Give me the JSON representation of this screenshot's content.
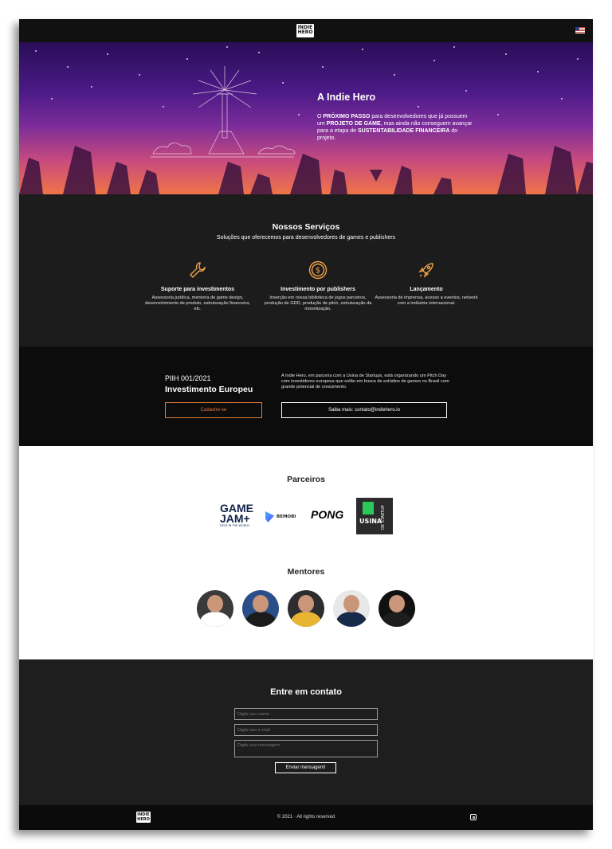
{
  "nav": {
    "logo_line1": "INDIE",
    "logo_line2": "HERO",
    "flag_icon": "us-flag-icon"
  },
  "hero": {
    "title": "A Indie Hero",
    "desc": [
      {
        "t": "O ",
        "b": false
      },
      {
        "t": "PRÓXIMO PASSO",
        "b": true
      },
      {
        "t": " para desenvolvedores que já possuem um ",
        "b": false
      },
      {
        "t": "PROJETO DE GAME",
        "b": true
      },
      {
        "t": ", mas ainda não conseguem avançar para a etapa de ",
        "b": false
      },
      {
        "t": "SUSTENTABILIDADE FINANCEIRA",
        "b": true
      },
      {
        "t": " do projeto.",
        "b": false
      }
    ]
  },
  "services": {
    "title": "Nossos Serviços",
    "subtitle": "Soluções que oferecemos para desenvolvedores de games e publishers",
    "items": [
      {
        "title": "Suporte para investimentos",
        "desc": "Assessoria jurídica, mentoria de game design, desenvolvimento de produto, estruturação financeira, etc.",
        "icon": "wrench-icon"
      },
      {
        "title": "Investimento por publishers",
        "desc": "Inserção em nossa biblioteca de jogos parceiros, produção de GDD, produção de pitch, estruturação da monetização.",
        "icon": "dollar-coin-icon"
      },
      {
        "title": "Lançamento",
        "desc": "Assessoria de imprensa, acesso a eventos, network com a indústria internacional.",
        "icon": "rocket-icon"
      }
    ],
    "accent": "#f0a24a"
  },
  "pitch": {
    "code": "PIIH 001/2021",
    "title": "Investimento Europeu",
    "text": "A Indie Hero, em parceria com a Usina de Startups, está organizando um Pitch Day com investidores europeus que estão em busca de estúdios de games no Brasil com grande potencial de crescimento.",
    "register_button": "Cadastre-se",
    "more_button": "Saiba mais: contato@indiehero.io"
  },
  "partners": {
    "title": "Parceiros",
    "gamejam_line1": "GAME",
    "gamejam_line2": "JAM+",
    "gamejam_tag": "DEVS IN THE WORLD",
    "bemobi": "BEMOBI",
    "pong": "PONG",
    "usina": "USINA",
    "usina_vertical": "DE STARTUP"
  },
  "mentors": {
    "title": "Mentores",
    "people": [
      {
        "bg": "#3a3a3a",
        "suit": "#ffffff"
      },
      {
        "bg": "#2a4f88",
        "suit": "#1b1b1b"
      },
      {
        "bg": "#2d2d30",
        "suit": "#e7b531"
      },
      {
        "bg": "#e8e8e8",
        "suit": "#182a4a"
      },
      {
        "bg": "#111111",
        "suit": "#1d1d1d"
      }
    ]
  },
  "contact": {
    "title": "Entre em contato",
    "name_placeholder": "Digite seu nome",
    "email_placeholder": "Digite seu e-mail",
    "message_placeholder": "Digite sua mensagem",
    "send_button": "Enviar mensagem!"
  },
  "footer": {
    "logo_line1": "INDIE",
    "logo_line2": "HERO",
    "copyright": "© 2021 · All rights reserved",
    "instagram_icon": "instagram-icon"
  }
}
